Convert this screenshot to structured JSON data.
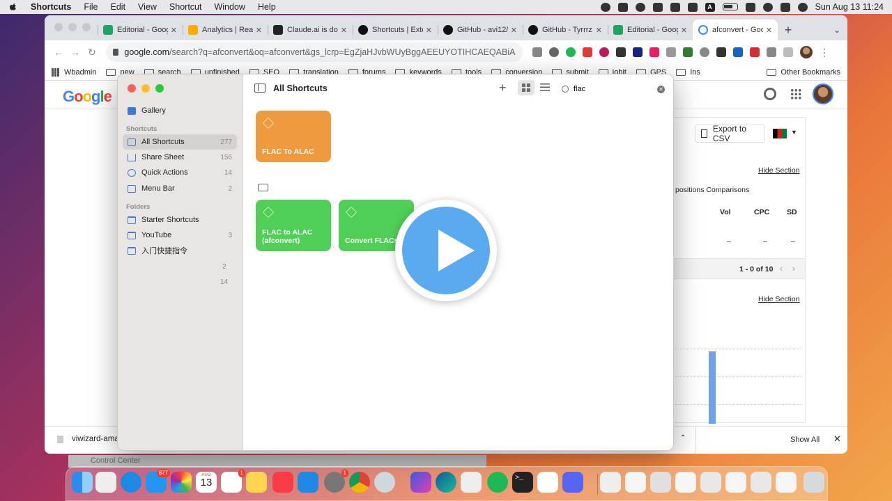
{
  "menubar": {
    "app": "Shortcuts",
    "menus": [
      "File",
      "Edit",
      "View",
      "Shortcut",
      "Window",
      "Help"
    ],
    "status_letter": "A",
    "clock": "Sun Aug 13  11:24"
  },
  "chrome": {
    "tabs": [
      {
        "title": "Editorial - Goog",
        "favicon_color": "#1ea362"
      },
      {
        "title": "Analytics | Real",
        "favicon_color": "#f9ab00"
      },
      {
        "title": "Claude.ai is do",
        "favicon_color": "#222222"
      },
      {
        "title": "Shortcuts | Exte",
        "favicon_color": "#111111"
      },
      {
        "title": "GitHub - avi12/",
        "favicon_color": "#111111"
      },
      {
        "title": "GitHub - Tyrrrz",
        "favicon_color": "#111111"
      },
      {
        "title": "Editorial - Goog",
        "favicon_color": "#1ea362"
      },
      {
        "title": "afconvert - Goo",
        "favicon_color": "#4285f4",
        "active": true
      }
    ],
    "new_tab": "+",
    "url_host": "google.com",
    "url_path": "/search?q=afconvert&oq=afconvert&gs_lcrp=EgZjaHJvbWUyBggAEEUYOTIHCAEQABiABDIH...",
    "bookmarks": [
      "Wbadmin",
      "new",
      "search",
      "unfinished",
      "SEO",
      "translation",
      "forums",
      "keywords",
      "tools",
      "conversion",
      "submit",
      "iobit",
      "GPS",
      "Ins"
    ],
    "other_bookmarks": "Other Bookmarks"
  },
  "google": {
    "logo": "Google",
    "export_csv": "Export to CSV",
    "hide_section": "Hide Section",
    "tabs_text": "positions  Comparisons",
    "columns": [
      "Vol",
      "CPC",
      "SD"
    ],
    "dashes": [
      "–",
      "–",
      "–"
    ],
    "pager": "1 - 0 of 10",
    "pager_prev": "‹",
    "pager_next": "›"
  },
  "download_bar": {
    "file": "viwizard-ama",
    "show_all": "Show All",
    "close": "✕",
    "chevron": "⌃"
  },
  "control_center_label": "Control Center",
  "shortcuts_app": {
    "sidebar": {
      "gallery": "Gallery",
      "section_shortcuts": "Shortcuts",
      "items": [
        {
          "label": "All Shortcuts",
          "count": "277"
        },
        {
          "label": "Share Sheet",
          "count": "156"
        },
        {
          "label": "Quick Actions",
          "count": "14"
        },
        {
          "label": "Menu Bar",
          "count": "2"
        }
      ],
      "section_folders": "Folders",
      "folders": [
        {
          "label": "Starter Shortcuts",
          "count": ""
        },
        {
          "label": "YouTube",
          "count": "3"
        },
        {
          "label": "入门快捷指令",
          "count": ""
        }
      ],
      "orphan_counts": [
        "2",
        "14"
      ]
    },
    "title": "All Shortcuts",
    "search_value": "flac",
    "cards": [
      {
        "label": "FLAC To ALAC",
        "color": "#f09a3e"
      },
      {
        "label": "FLAC to ALAC (afconvert)",
        "color": "#4fcf56"
      },
      {
        "label": "Convert FLACs",
        "color": "#4fcf56"
      }
    ]
  },
  "dock": {
    "mail_badge": "877",
    "reminders_badge": "1",
    "sysprefs_badge": "1",
    "calendar_month": "AUG",
    "calendar_day": "13",
    "terminal_prompt": ">_"
  }
}
